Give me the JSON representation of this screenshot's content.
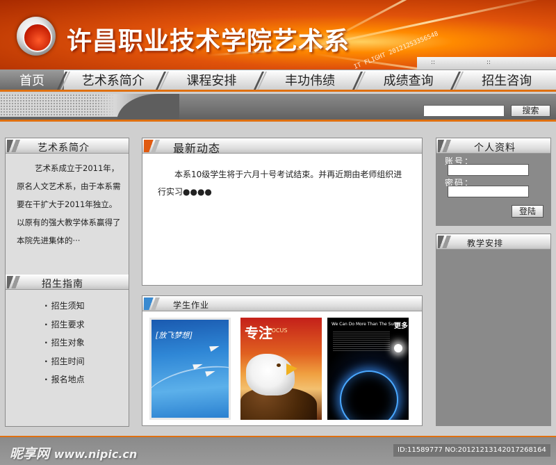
{
  "site": {
    "title": "许昌职业技术学院艺术系",
    "deco_text": "IT FLIGHT 20121253356548"
  },
  "nav": {
    "items": [
      "首页",
      "艺术系简介",
      "课程安排",
      "丰功伟绩",
      "成绩查询",
      "招生咨询"
    ]
  },
  "search": {
    "placeholder": "",
    "button": "搜索"
  },
  "intro": {
    "title": "艺术系简介",
    "text": "艺术系成立于2011年，原名人文艺术系，由于本系需要在干扩大于2011年独立。以原有的强大教学体系赢得了本院先进集体的···"
  },
  "guide": {
    "title": "招生指南",
    "items": [
      "招生须知",
      "招生要求",
      "招生对象",
      "招生时间",
      "报名地点"
    ]
  },
  "news": {
    "title": "最新动态",
    "body": "本系10级学生将于六月十号考试结束。并再近期由老师组织进行实习●●●●"
  },
  "homework": {
    "title": "学生作业",
    "thumbs": [
      {
        "title": "[放飞梦想]"
      },
      {
        "title": "专注",
        "subtitle": "FOCUS"
      },
      {
        "title": "We Can Do More Than The Sun",
        "big": "更多"
      }
    ]
  },
  "profile": {
    "title": "个人资料",
    "account_label": "账号：",
    "password_label": "密码：",
    "login_button": "登陆"
  },
  "schedule": {
    "title": "教学安排"
  },
  "footer": {
    "logo_text": "昵享网",
    "url": "www.nipic.cn",
    "id_text": "ID:11589777 NO:20121213142017268164"
  },
  "colors": {
    "accent": "#e07010",
    "panel": "#8a8a8a",
    "brand": "#e0520a"
  }
}
